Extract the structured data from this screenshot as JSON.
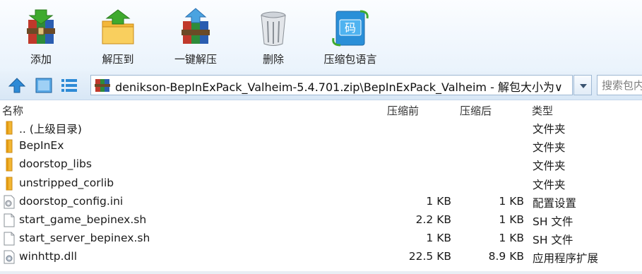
{
  "toolbar": {
    "add_label": "添加",
    "extract_to_label": "解压到",
    "one_click_extract_label": "一键解压",
    "delete_label": "删除",
    "code_page_label": "压缩包语言"
  },
  "address": {
    "path": "denikson-BepInExPack_Valheim-5.4.701.zip\\BepInExPack_Valheim - 解包大小为∨"
  },
  "search": {
    "placeholder": "搜索包内"
  },
  "columns": {
    "name": "名称",
    "size": "压缩前",
    "packed": "压缩后",
    "type": "类型"
  },
  "files": [
    {
      "name": ".. (上级目录)",
      "size": "",
      "packed": "",
      "type": "文件夹",
      "icon": "folder-icon"
    },
    {
      "name": "BepInEx",
      "size": "",
      "packed": "",
      "type": "文件夹",
      "icon": "folder-icon"
    },
    {
      "name": "doorstop_libs",
      "size": "",
      "packed": "",
      "type": "文件夹",
      "icon": "folder-icon"
    },
    {
      "name": "unstripped_corlib",
      "size": "",
      "packed": "",
      "type": "文件夹",
      "icon": "folder-icon"
    },
    {
      "name": "doorstop_config.ini",
      "size": "1 KB",
      "packed": "1 KB",
      "type": "配置设置",
      "icon": "config-file-icon"
    },
    {
      "name": "start_game_bepinex.sh",
      "size": "2.2 KB",
      "packed": "1 KB",
      "type": "SH 文件",
      "icon": "file-icon"
    },
    {
      "name": "start_server_bepinex.sh",
      "size": "1 KB",
      "packed": "1 KB",
      "type": "SH 文件",
      "icon": "file-icon"
    },
    {
      "name": "winhttp.dll",
      "size": "22.5 KB",
      "packed": "8.9 KB",
      "type": "应用程序扩展",
      "icon": "dll-file-icon"
    }
  ]
}
